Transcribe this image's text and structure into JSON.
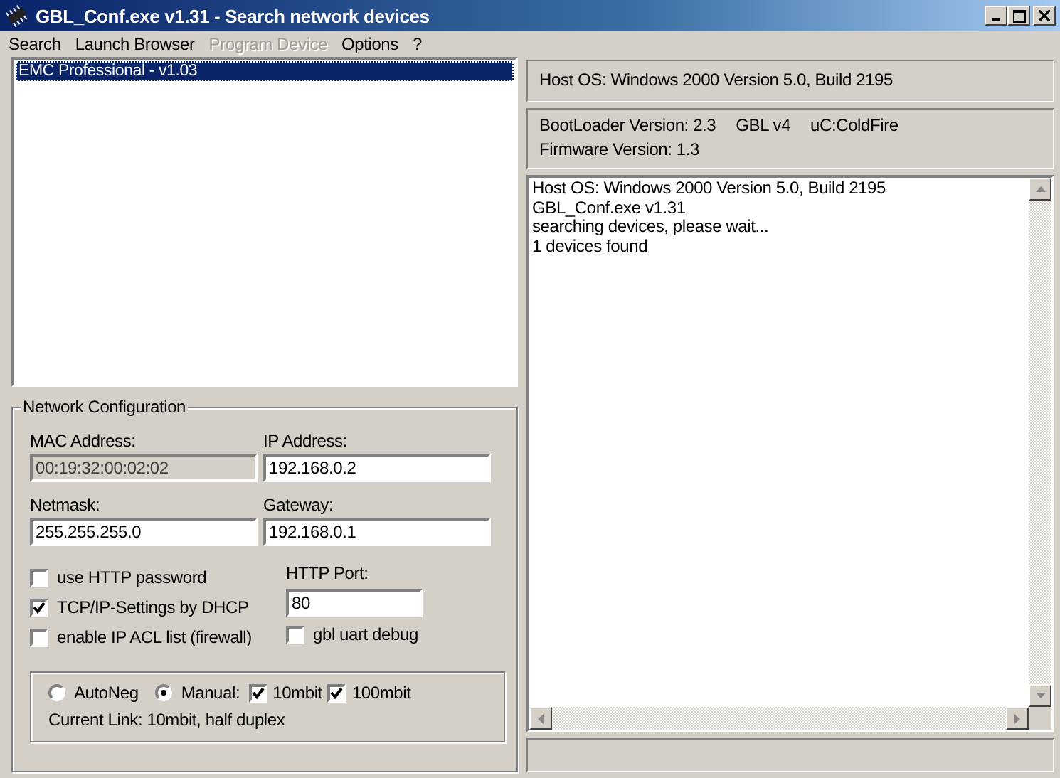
{
  "window": {
    "title": "GBL_Conf.exe v1.31  - Search network devices"
  },
  "menu": [
    {
      "label": "Search",
      "disabled": false
    },
    {
      "label": "Launch Browser",
      "disabled": false
    },
    {
      "label": "Program Device",
      "disabled": true
    },
    {
      "label": "Options",
      "disabled": false
    },
    {
      "label": "?",
      "disabled": false
    }
  ],
  "device_list": [
    {
      "label": "EMC Professional - v1.03",
      "selected": true
    }
  ],
  "network_configuration": {
    "title": "Network Configuration",
    "fields": [
      {
        "label": "MAC Address:",
        "value": "00:19:32:00:02:02",
        "disabled": true
      },
      {
        "label": "IP Address:",
        "value": "192.168.0.2",
        "disabled": false
      },
      {
        "label": "Netmask:",
        "value": "255.255.255.0",
        "disabled": false
      },
      {
        "label": "Gateway:",
        "value": "192.168.0.1",
        "disabled": false
      }
    ],
    "checkboxes": [
      {
        "label": "use HTTP password",
        "checked": false
      },
      {
        "label": "TCP/IP-Settings by DHCP",
        "checked": true
      },
      {
        "label": "enable IP ACL list (firewall)",
        "checked": false
      }
    ],
    "http_port": {
      "label": "HTTP Port:",
      "value": "80"
    },
    "debug_checkbox": {
      "label": "gbl uart debug",
      "checked": false
    },
    "link": {
      "radios": [
        {
          "label": "AutoNeg",
          "selected": false
        },
        {
          "label": "Manual:",
          "selected": true
        }
      ],
      "speeds": [
        {
          "label": "10mbit",
          "checked": true
        },
        {
          "label": "100mbit",
          "checked": true
        }
      ],
      "current_link": "Current Link: 10mbit, half duplex"
    }
  },
  "host_info": "Host OS: Windows 2000 Version 5.0, Build 2195",
  "device_info": {
    "items": [
      "BootLoader Version: 2.3",
      "GBL v4",
      "uC:ColdFire"
    ],
    "firmware": "Firmware Version: 1.3"
  },
  "log": [
    "Host OS: Windows 2000 Version 5.0, Build 2195",
    "GBL_Conf.exe v1.31",
    "searching devices, please wait...",
    "1 devices found"
  ]
}
